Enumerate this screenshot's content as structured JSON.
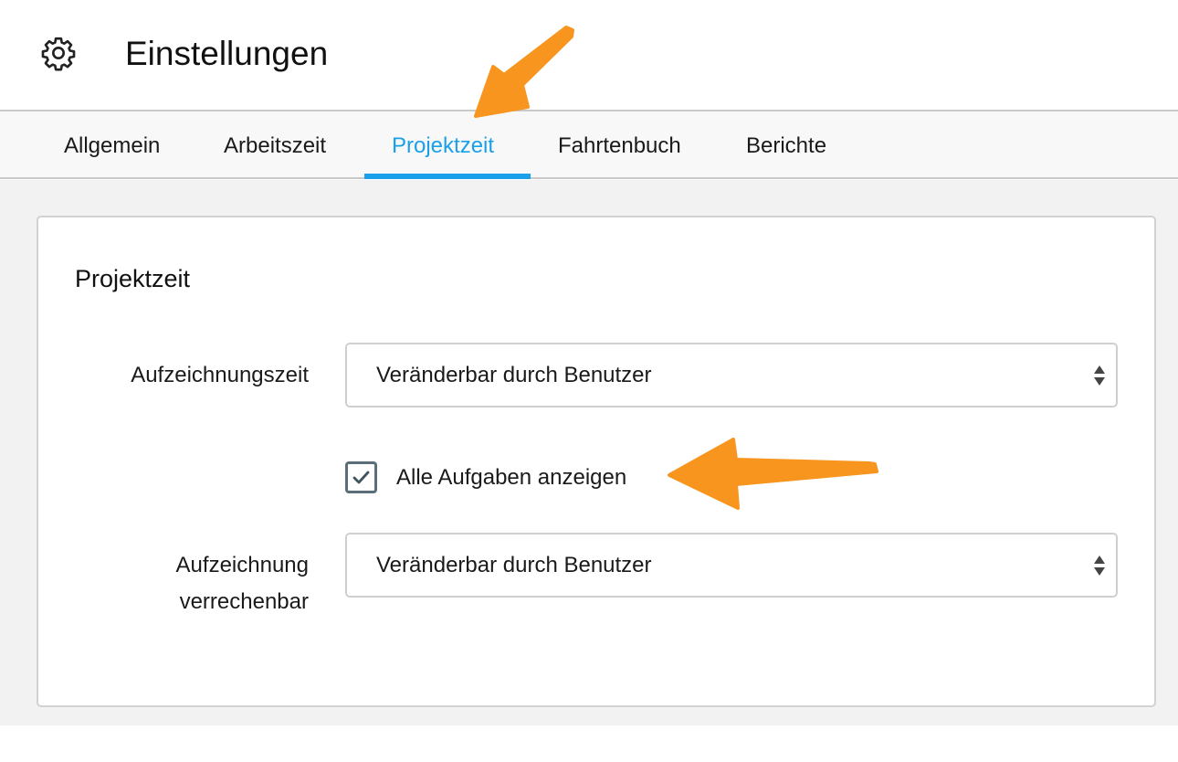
{
  "header": {
    "icon": "gear-icon",
    "title": "Einstellungen"
  },
  "tabs": [
    {
      "label": "Allgemein",
      "active": false
    },
    {
      "label": "Arbeitszeit",
      "active": false
    },
    {
      "label": "Projektzeit",
      "active": true
    },
    {
      "label": "Fahrtenbuch",
      "active": false
    },
    {
      "label": "Berichte",
      "active": false
    }
  ],
  "panel": {
    "title": "Projektzeit",
    "recording_time": {
      "label": "Aufzeichnungszeit",
      "value": "Veränderbar durch Benutzer"
    },
    "show_all_tasks": {
      "label": "Alle Aufgaben anzeigen",
      "checked": true
    },
    "billable": {
      "label_line1": "Aufzeichnung",
      "label_line2": "verrechenbar",
      "value": "Veränderbar durch Benutzer"
    }
  },
  "colors": {
    "accent": "#1aa0e8",
    "annotation_arrow": "#f7951f",
    "checkbox_border": "#5b6f7a"
  }
}
